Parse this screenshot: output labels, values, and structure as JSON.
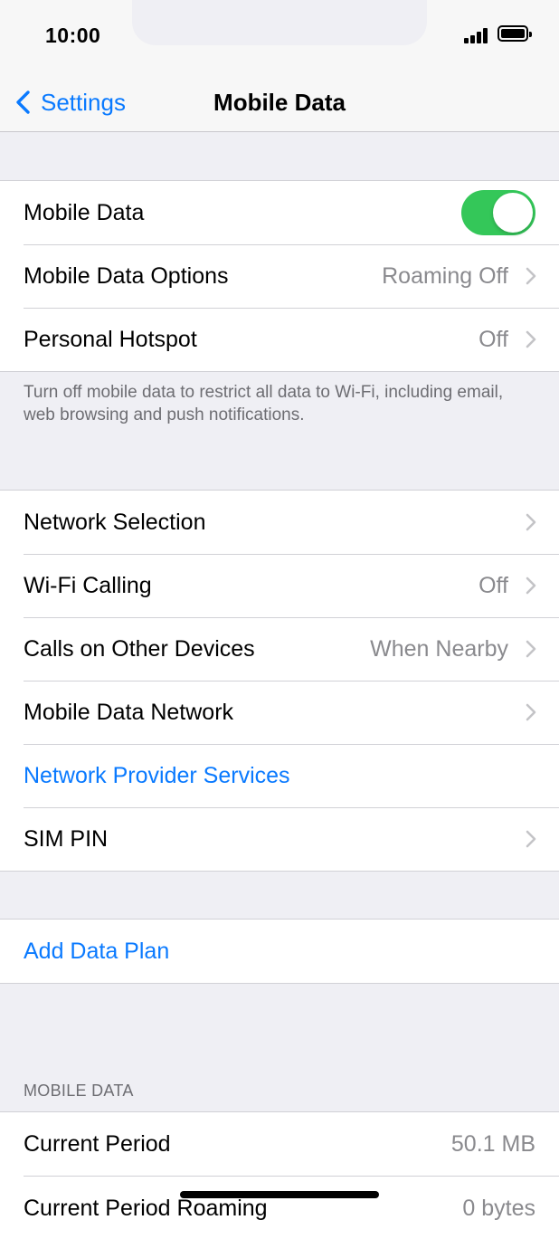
{
  "status_bar": {
    "time": "10:00"
  },
  "nav": {
    "back_label": "Settings",
    "title": "Mobile Data"
  },
  "group1": {
    "mobile_data": {
      "label": "Mobile Data",
      "toggle_on": true
    },
    "options": {
      "label": "Mobile Data Options",
      "value": "Roaming Off"
    },
    "hotspot": {
      "label": "Personal Hotspot",
      "value": "Off"
    },
    "footer": "Turn off mobile data to restrict all data to Wi-Fi, including email, web browsing and push notifications."
  },
  "group2": {
    "network_selection": {
      "label": "Network Selection"
    },
    "wifi_calling": {
      "label": "Wi-Fi Calling",
      "value": "Off"
    },
    "calls_other": {
      "label": "Calls on Other Devices",
      "value": "When Nearby"
    },
    "data_network": {
      "label": "Mobile Data Network"
    },
    "provider_services": {
      "label": "Network Provider Services"
    },
    "sim_pin": {
      "label": "SIM PIN"
    }
  },
  "group3": {
    "add_plan": {
      "label": "Add Data Plan"
    }
  },
  "mobile_data_section": {
    "header": "MOBILE DATA",
    "current_period": {
      "label": "Current Period",
      "value": "50.1 MB"
    },
    "current_period_roaming": {
      "label": "Current Period Roaming",
      "value": "0 bytes"
    }
  },
  "colors": {
    "accent": "#0a7aff",
    "toggle_on": "#34c759"
  }
}
